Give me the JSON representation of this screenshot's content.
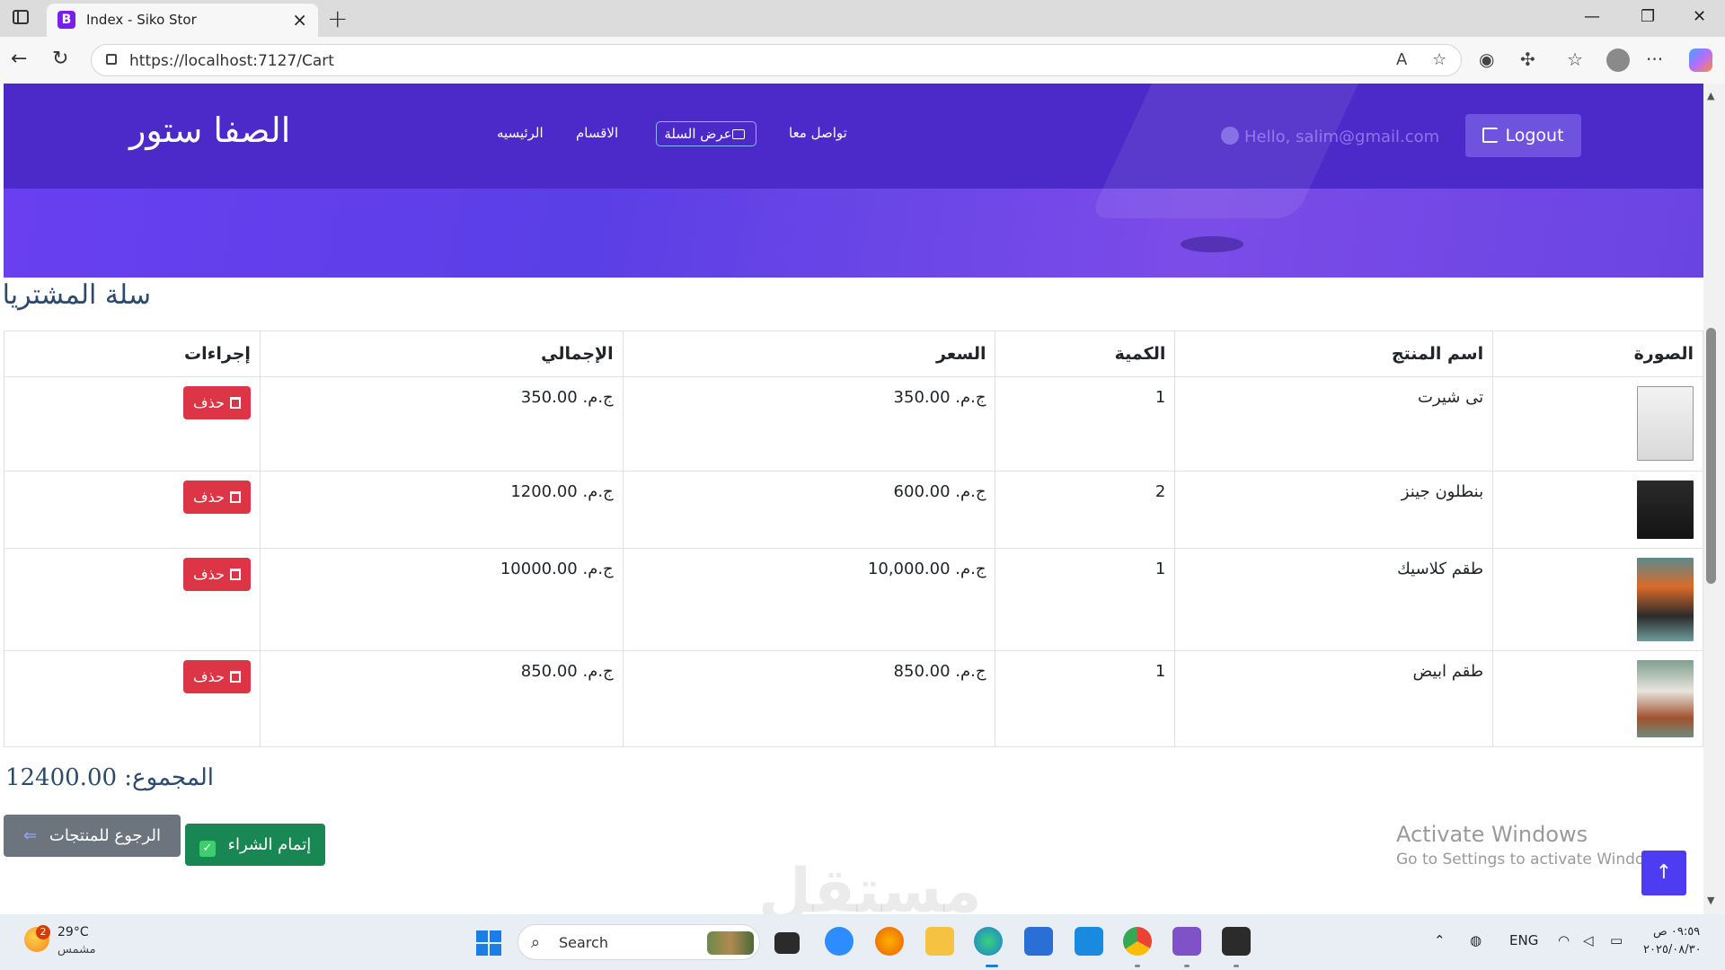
{
  "browser": {
    "tab_title": "Index - Siko Stor",
    "tab_icon_letter": "B",
    "url": "https://localhost:7127/Cart"
  },
  "navbar": {
    "brand": "الصفا ستور",
    "links": [
      "الرئيسيه",
      "الاقسام",
      "عرض السلة",
      "تواصل معا"
    ],
    "greeting": "Hello, salim@gmail.com",
    "logout_label": "Logout"
  },
  "cart": {
    "heading": "سلة المشتريات",
    "columns": [
      "الصورة",
      "اسم المنتج",
      "الكمية",
      "السعر",
      "الإجمالي",
      "إجراءات"
    ],
    "rows": [
      {
        "name": "تى شيرت",
        "qty": "1",
        "price": "ج.م. 350.00",
        "total": "ج.م. 350.00",
        "delete": "حذف"
      },
      {
        "name": "بنطلون جينز",
        "qty": "2",
        "price": "ج.م. 600.00",
        "total": "ج.م. 1200.00",
        "delete": "حذف"
      },
      {
        "name": "طقم كلاسيك",
        "qty": "1",
        "price": "ج.م. 10,000.00",
        "total": "ج.م. 10000.00",
        "delete": "حذف"
      },
      {
        "name": "طقم ابيض",
        "qty": "1",
        "price": "ج.م. 850.00",
        "total": "ج.م. 850.00",
        "delete": "حذف"
      }
    ],
    "grand_total": "المجموع: 12400.00 ج.م",
    "back_button": "الرجوع للمنتجات",
    "checkout_button": "إتمام الشراء"
  },
  "overlay": {
    "activate_title": "Activate Windows",
    "activate_sub": "Go to Settings to activate Windows.",
    "watermark": "مستقل"
  },
  "taskbar": {
    "temperature": "29°C",
    "weather_desc": "مشمس",
    "weather_badge": "2",
    "search_label": "Search",
    "lang": "ENG",
    "time": "٠٩:٥٩ ص",
    "date": "٢٠٢٥/٠٨/٣٠"
  },
  "colors": {
    "navbar": "#4c29c9",
    "hero": "#6a3ff0",
    "delete": "#dc3545",
    "checkout": "#198754",
    "back": "#6c757d",
    "logout": "#6d53dd",
    "to_top": "#4d3cf2"
  }
}
